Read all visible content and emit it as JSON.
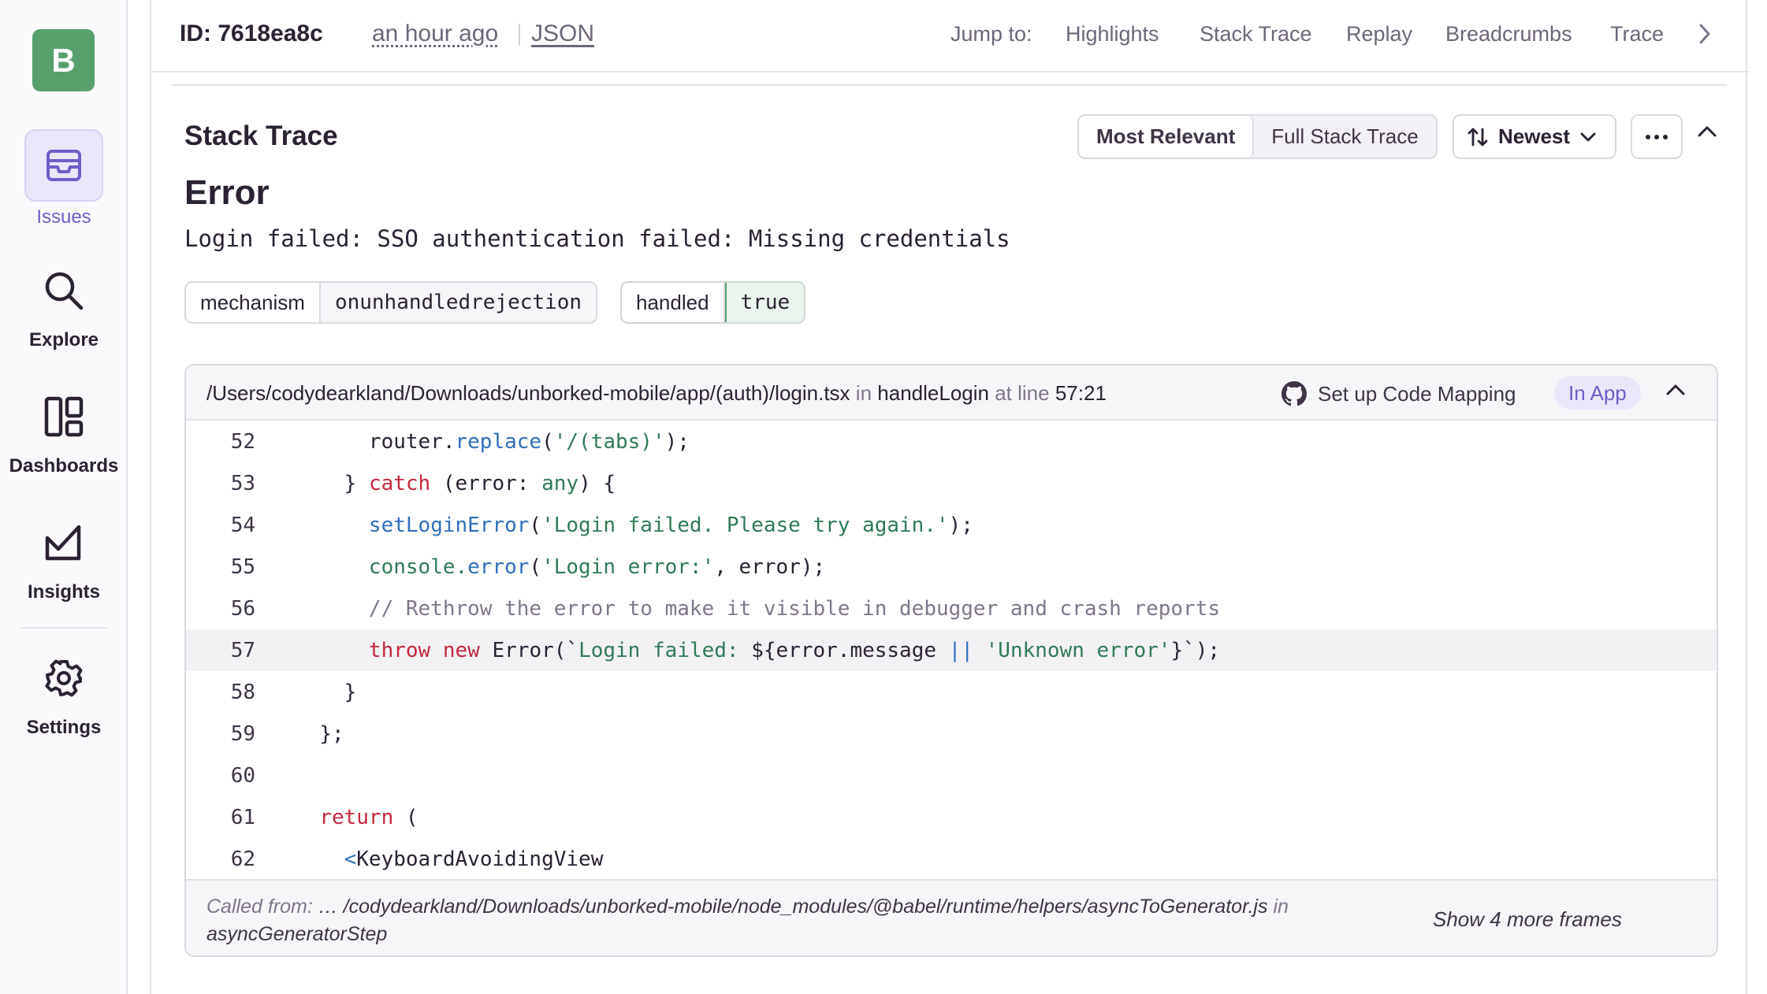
{
  "sidebar": {
    "org_initial": "B",
    "items": [
      {
        "label": "Issues",
        "icon": "issues-icon"
      },
      {
        "label": "Explore",
        "icon": "search-icon"
      },
      {
        "label": "Dashboards",
        "icon": "dashboards-icon"
      },
      {
        "label": "Insights",
        "icon": "insights-icon"
      },
      {
        "label": "Settings",
        "icon": "gear-icon"
      }
    ],
    "accent": "#6c5fc7",
    "org_color": "#57a06c"
  },
  "topbar": {
    "event_id": "ID: 7618ea8c",
    "time": "an hour ago",
    "json_link": "JSON",
    "jump_label": "Jump to:",
    "jump_links": [
      "Highlights",
      "Stack Trace",
      "Replay",
      "Breadcrumbs",
      "Trace"
    ]
  },
  "stack_trace": {
    "title": "Stack Trace",
    "view_options": [
      "Most Relevant",
      "Full Stack Trace"
    ],
    "sort_label": "Newest",
    "error_type": "Error",
    "error_message": "Login failed: SSO authentication failed: Missing credentials",
    "tags": [
      {
        "key": "mechanism",
        "value": "onunhandledrejection"
      },
      {
        "key": "handled",
        "value": "true"
      }
    ]
  },
  "frame": {
    "path": "/Users/codydearkland/Downloads/unborked-mobile/app/(auth)/login.tsx",
    "in_word": "in",
    "function": "handleLogin",
    "at_line_word": "at line",
    "location": "57:21",
    "code_mapping": "Set up Code Mapping",
    "in_app": "In App",
    "lines": [
      {
        "num": "52"
      },
      {
        "num": "53"
      },
      {
        "num": "54"
      },
      {
        "num": "55"
      },
      {
        "num": "56"
      },
      {
        "num": "57"
      },
      {
        "num": "58"
      },
      {
        "num": "59"
      },
      {
        "num": "60"
      },
      {
        "num": "61"
      },
      {
        "num": "62"
      }
    ],
    "called_from_label": "Called from:",
    "called_from_path": "… /codydearkland/Downloads/unborked-mobile/node_modules/@babel/runtime/helpers/asyncToGenerator.js",
    "called_from_in": "in",
    "called_from_fn": "asyncGeneratorStep",
    "show_more": "Show 4 more frames"
  },
  "code_tokens": {
    "l52": {
      "a": "router.",
      "b": "replace",
      "c": "(",
      "d": "'/(tabs)'",
      "e": ");"
    },
    "l53": {
      "a": "} ",
      "b": "catch",
      "c": " (error: ",
      "d": "any",
      "e": ") {"
    },
    "l54": {
      "a": "setLoginError",
      "b": "(",
      "c": "'Login failed. Please try again.'",
      "d": ");"
    },
    "l55": {
      "a": "console.",
      "b": "error",
      "c": "(",
      "d": "'Login error:'",
      "e": ", error);"
    },
    "l56": {
      "a": "// Rethrow the error to make it visible in debugger and crash reports"
    },
    "l57": {
      "a": "throw",
      "b": " ",
      "c": "new",
      "d": " Error(`",
      "e": "Login failed: ",
      "f": "${error.message ",
      "g": "||",
      "h": " ",
      "i": "'Unknown error'",
      "j": "}`);"
    },
    "l58": {
      "a": "}"
    },
    "l59": {
      "a": "};"
    },
    "l61": {
      "a": "return",
      "b": " ("
    },
    "l62": {
      "a": "<",
      "b": "KeyboardAvoidingView"
    }
  }
}
